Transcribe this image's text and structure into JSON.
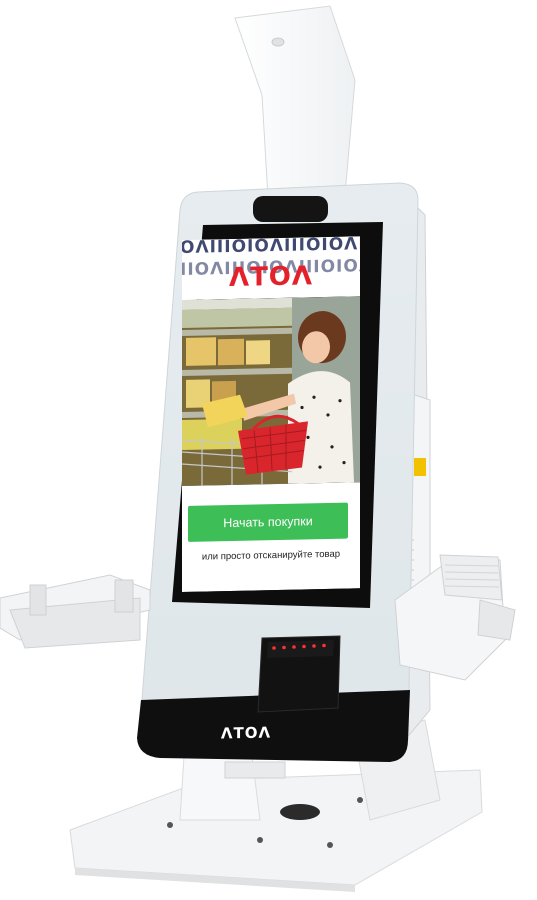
{
  "screen": {
    "brand_logo": "ΛΤΟΛ",
    "pattern_row_1": "OΛIIIOIOΛIIIOIOΛIII",
    "pattern_row_2": "IIOΛIIIOIOΛIIIOIOΛ",
    "start_button_label": "Начать покупки",
    "scan_hint": "или просто отсканируйте товар"
  },
  "device": {
    "bezel_logo": "ΛΤΟΛ"
  },
  "colors": {
    "brand_red": "#e4202a",
    "button_green": "#3dbe57",
    "basket_red": "#d8262c",
    "bezel_black": "#0f0f10",
    "screen_frame": "#e4e9ec"
  }
}
